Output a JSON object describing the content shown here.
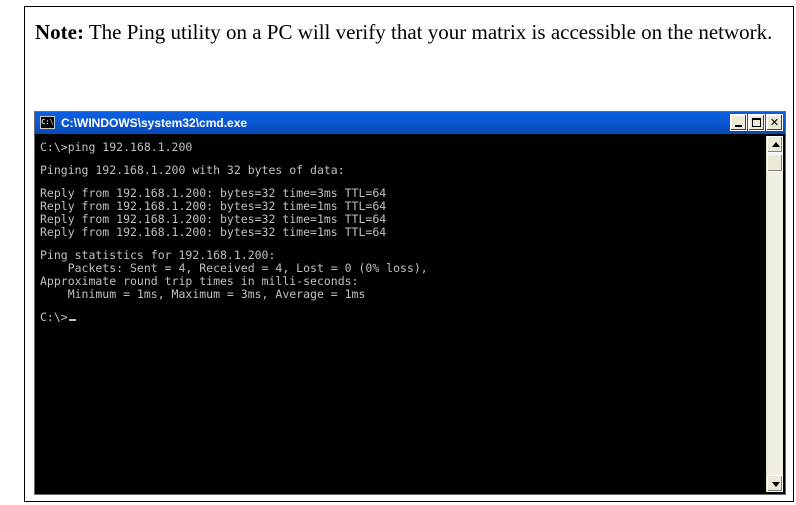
{
  "note": {
    "label": "Note:",
    "text": " The Ping utility on a PC will verify that your matrix is accessible on the network."
  },
  "window": {
    "title": "C:\\WINDOWS\\system32\\cmd.exe",
    "icon": "cmd-icon",
    "icon_glyph": "C:\\"
  },
  "console": {
    "lines": [
      "C:\\>ping 192.168.1.200",
      "",
      "Pinging 192.168.1.200 with 32 bytes of data:",
      "",
      "Reply from 192.168.1.200: bytes=32 time=3ms TTL=64",
      "Reply from 192.168.1.200: bytes=32 time=1ms TTL=64",
      "Reply from 192.168.1.200: bytes=32 time=1ms TTL=64",
      "Reply from 192.168.1.200: bytes=32 time=1ms TTL=64",
      "",
      "Ping statistics for 192.168.1.200:",
      "    Packets: Sent = 4, Received = 4, Lost = 0 (0% loss),",
      "Approximate round trip times in milli-seconds:",
      "    Minimum = 1ms, Maximum = 3ms, Average = 1ms",
      "",
      "C:\\>"
    ]
  },
  "colors": {
    "titlebar": "#0a5ee0",
    "console_bg": "#000000",
    "console_fg": "#c0c0c0"
  }
}
